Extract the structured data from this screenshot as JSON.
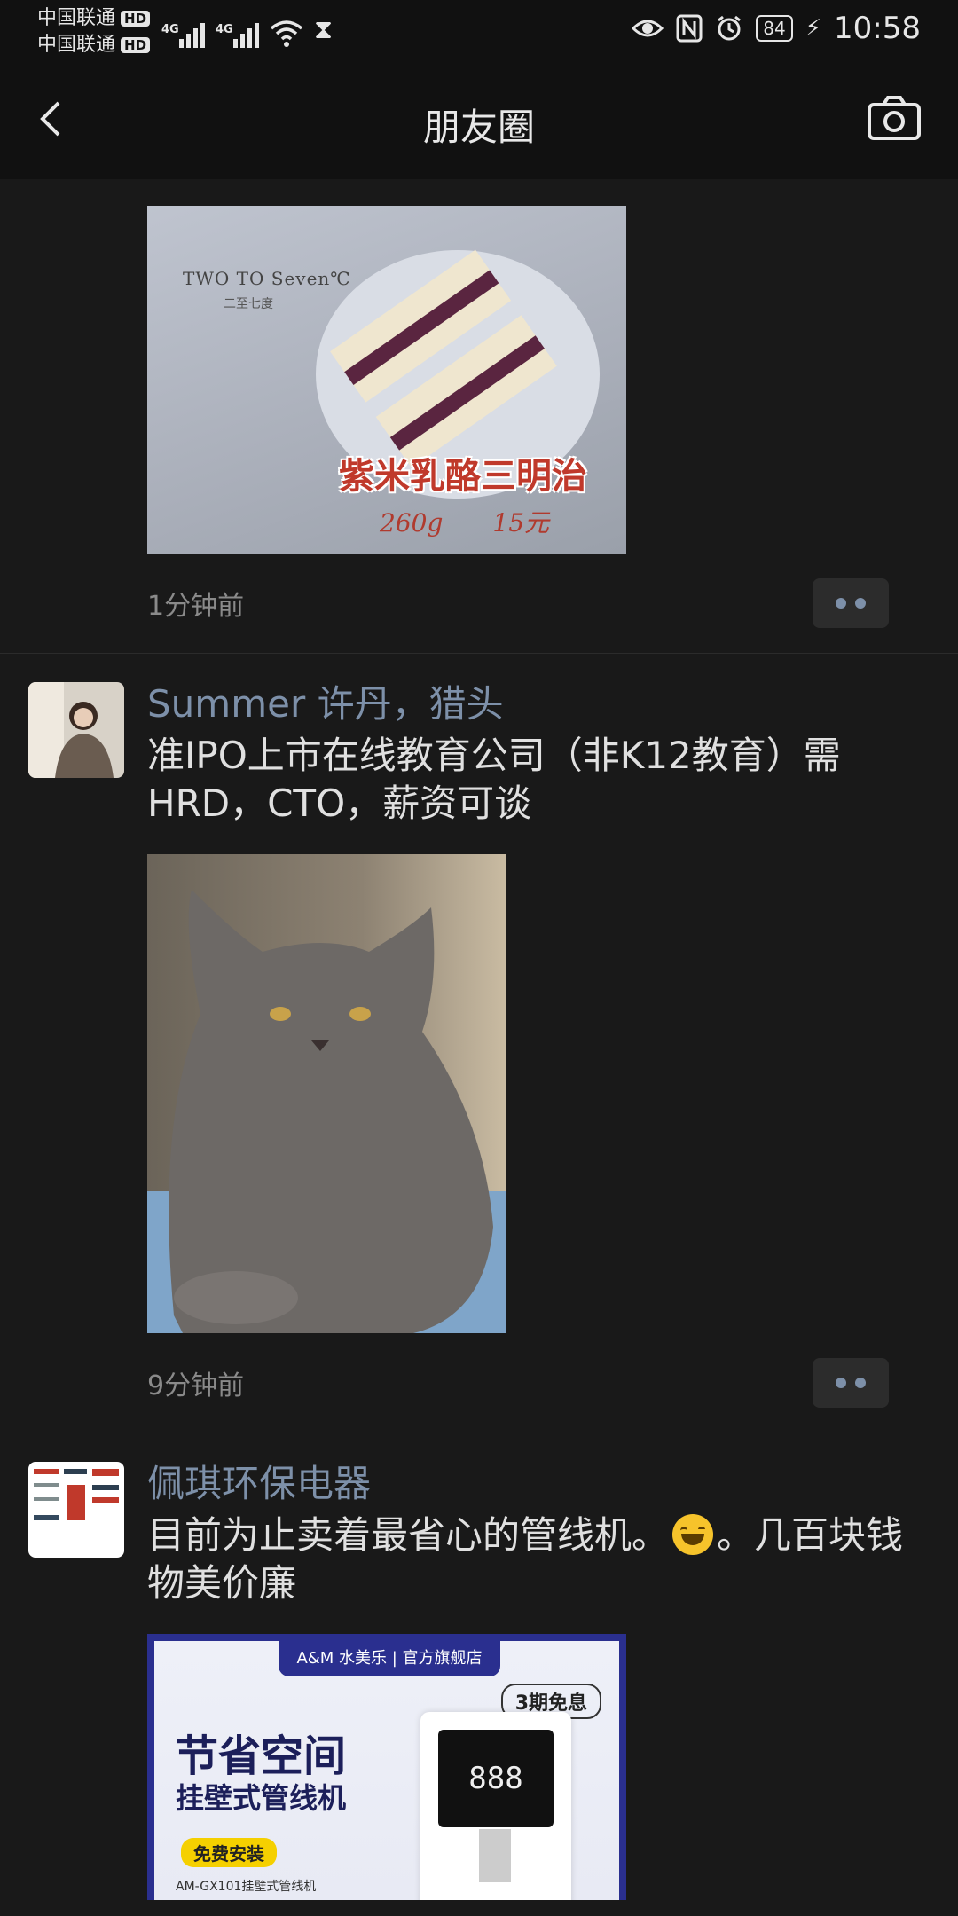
{
  "status_bar": {
    "carrier_1": "中国联通",
    "carrier_2": "中国联通",
    "hd": "HD",
    "net_1": "4G",
    "net_2": "4G",
    "battery": "84",
    "time": "10:58"
  },
  "nav": {
    "title": "朋友圈",
    "back_icon": "chevron-left-icon",
    "camera_icon": "camera-icon"
  },
  "posts": [
    {
      "image_text": "紫米乳酪三明治",
      "image_weight": "260g",
      "image_price": "15元",
      "image_brand": "TWO TO Seven℃",
      "image_brand_sub": "二至七度",
      "time": "1分钟前"
    },
    {
      "nickname": "Summer  许丹，猎头",
      "text": "准IPO上市在线教育公司（非K12教育）需HRD，CTO，薪资可谈",
      "time": "9分钟前"
    },
    {
      "nickname": "佩琪环保电器",
      "text_before": "目前为止卖着最省心的管线机。",
      "emoji": "grinning-face-emoji",
      "text_after": "。几百块钱物美价廉",
      "ad_header": "A&M 水美乐 | 官方旗舰店",
      "ad_badge": "3期免息",
      "ad_title1": "节省空间",
      "ad_title2": "挂壁式管线机",
      "ad_install": "免费安装",
      "ad_model": "AM-GX101挂壁式管线机",
      "ad_display": "888"
    }
  ],
  "colors": {
    "background": "#191919",
    "nickname": "#7d90a9",
    "more_dots": "#7d90a9"
  }
}
